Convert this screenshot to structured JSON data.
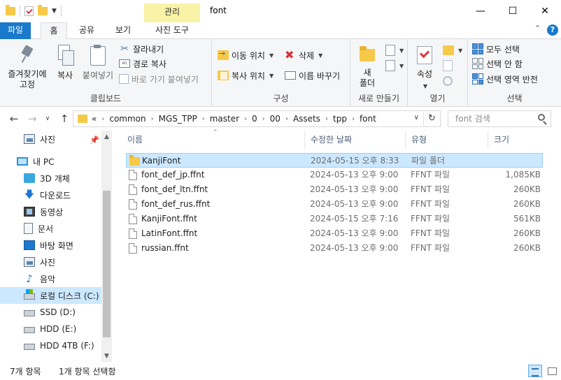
{
  "window": {
    "title": "font",
    "context_tab": "관리",
    "minimize_icon": "minimize-icon",
    "maximize_icon": "maximize-icon",
    "close_icon": "close-icon"
  },
  "ribbon_tabs": {
    "file": "파일",
    "home": "홈",
    "share": "공유",
    "view": "보기",
    "picture_tools": "사진 도구"
  },
  "ribbon": {
    "clipboard": {
      "label": "클립보드",
      "pin": "즐겨찾기에\n고정",
      "pin_line1": "즐겨찾기에",
      "pin_line2": "고정",
      "copy": "복사",
      "paste": "붙여넣기",
      "cut": "잘라내기",
      "copy_path": "경로 복사",
      "paste_shortcut": "바로 가기 붙여넣기"
    },
    "organize": {
      "label": "구성",
      "move_to": "이동 위치",
      "copy_to": "복사 위치",
      "delete": "삭제",
      "rename": "이름 바꾸기"
    },
    "new": {
      "label": "새로 만들기",
      "new_folder_line1": "새",
      "new_folder_line2": "폴더"
    },
    "open": {
      "label": "열기",
      "properties": "속성"
    },
    "select": {
      "label": "선택",
      "select_all": "모두 선택",
      "select_none": "선택 안 함",
      "invert": "선택 영역 반전"
    }
  },
  "address": {
    "overflow": "«",
    "crumbs": [
      "common",
      "MGS_TPP",
      "master",
      "0",
      "00",
      "Assets",
      "tpp",
      "font"
    ],
    "search_placeholder": "font 검색"
  },
  "nav": {
    "items": [
      {
        "label": "사진",
        "icon": "photo-icon"
      },
      {
        "label": "내 PC",
        "icon": "pc-icon"
      },
      {
        "label": "3D 개체",
        "icon": "3d-objects-icon"
      },
      {
        "label": "다운로드",
        "icon": "download-icon"
      },
      {
        "label": "동영상",
        "icon": "video-icon"
      },
      {
        "label": "문서",
        "icon": "document-icon"
      },
      {
        "label": "바탕 화면",
        "icon": "desktop-icon"
      },
      {
        "label": "사진",
        "icon": "photo-icon"
      },
      {
        "label": "음악",
        "icon": "music-icon"
      },
      {
        "label": "로컬 디스크 (C:)",
        "icon": "drive-c-icon"
      },
      {
        "label": "SSD (D:)",
        "icon": "drive-icon"
      },
      {
        "label": "HDD (E:)",
        "icon": "drive-icon"
      },
      {
        "label": "HDD 4TB (F:)",
        "icon": "drive-icon"
      }
    ]
  },
  "columns": {
    "name": "이름",
    "date": "수정한 날짜",
    "type": "유형",
    "size": "크기"
  },
  "files": [
    {
      "name": "KanjiFont",
      "date": "2024-05-15 오후 8:33",
      "type": "파일 폴더",
      "size": "",
      "icon": "folder-icon"
    },
    {
      "name": "font_def_jp.ffnt",
      "date": "2024-05-13 오후 9:00",
      "type": "FFNT 파일",
      "size": "1,085KB",
      "icon": "file-icon"
    },
    {
      "name": "font_def_ltn.ffnt",
      "date": "2024-05-13 오후 9:00",
      "type": "FFNT 파일",
      "size": "260KB",
      "icon": "file-icon"
    },
    {
      "name": "font_def_rus.ffnt",
      "date": "2024-05-13 오후 9:00",
      "type": "FFNT 파일",
      "size": "260KB",
      "icon": "file-icon"
    },
    {
      "name": "KanjiFont.ffnt",
      "date": "2024-05-15 오후 7:16",
      "type": "FFNT 파일",
      "size": "561KB",
      "icon": "file-icon"
    },
    {
      "name": "LatinFont.ffnt",
      "date": "2024-05-13 오후 9:00",
      "type": "FFNT 파일",
      "size": "260KB",
      "icon": "file-icon"
    },
    {
      "name": "russian.ffnt",
      "date": "2024-05-13 오후 9:00",
      "type": "FFNT 파일",
      "size": "260KB",
      "icon": "file-icon"
    }
  ],
  "status": {
    "item_count": "7개 항목",
    "selected": "1개 항목 선택함"
  },
  "colors": {
    "accent": "#1979ca",
    "selection": "#cce8ff",
    "context_tab": "#f8f3a6"
  }
}
